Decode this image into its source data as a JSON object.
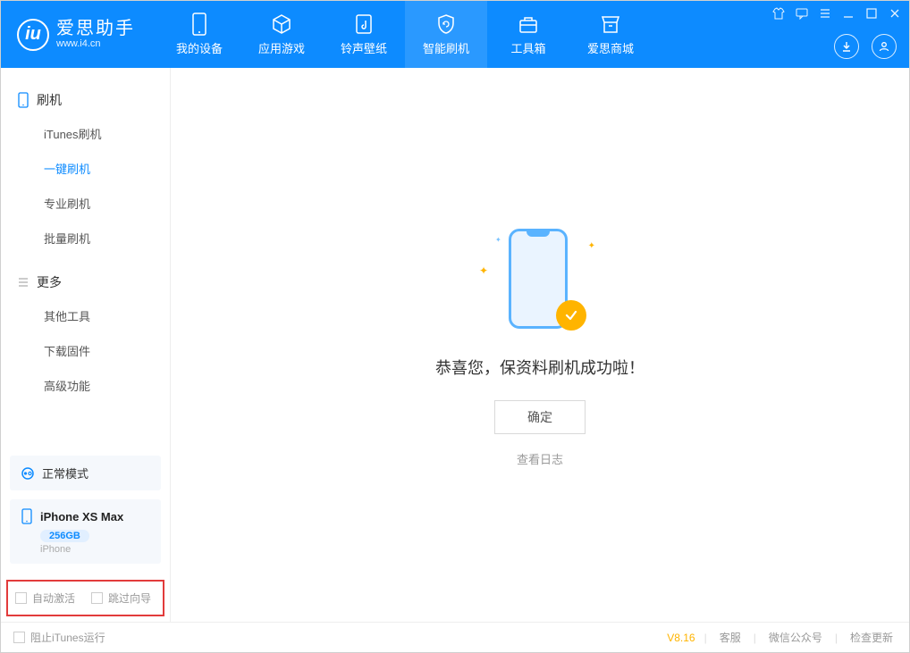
{
  "app": {
    "title": "爱思助手",
    "subtitle": "www.i4.cn"
  },
  "tabs": [
    {
      "label": "我的设备"
    },
    {
      "label": "应用游戏"
    },
    {
      "label": "铃声壁纸"
    },
    {
      "label": "智能刷机"
    },
    {
      "label": "工具箱"
    },
    {
      "label": "爱思商城"
    }
  ],
  "sidebar": {
    "group1": {
      "title": "刷机",
      "items": [
        {
          "label": "iTunes刷机"
        },
        {
          "label": "一键刷机"
        },
        {
          "label": "专业刷机"
        },
        {
          "label": "批量刷机"
        }
      ]
    },
    "group2": {
      "title": "更多",
      "items": [
        {
          "label": "其他工具"
        },
        {
          "label": "下载固件"
        },
        {
          "label": "高级功能"
        }
      ]
    }
  },
  "device": {
    "mode": "正常模式",
    "name": "iPhone XS Max",
    "capacity": "256GB",
    "type": "iPhone"
  },
  "options": {
    "auto_activate": "自动激活",
    "skip_guide": "跳过向导"
  },
  "main": {
    "success_text": "恭喜您，保资料刷机成功啦！",
    "ok_label": "确定",
    "log_link": "查看日志"
  },
  "footer": {
    "block_itunes": "阻止iTunes运行",
    "version": "V8.16",
    "links": [
      "客服",
      "微信公众号",
      "检查更新"
    ]
  }
}
